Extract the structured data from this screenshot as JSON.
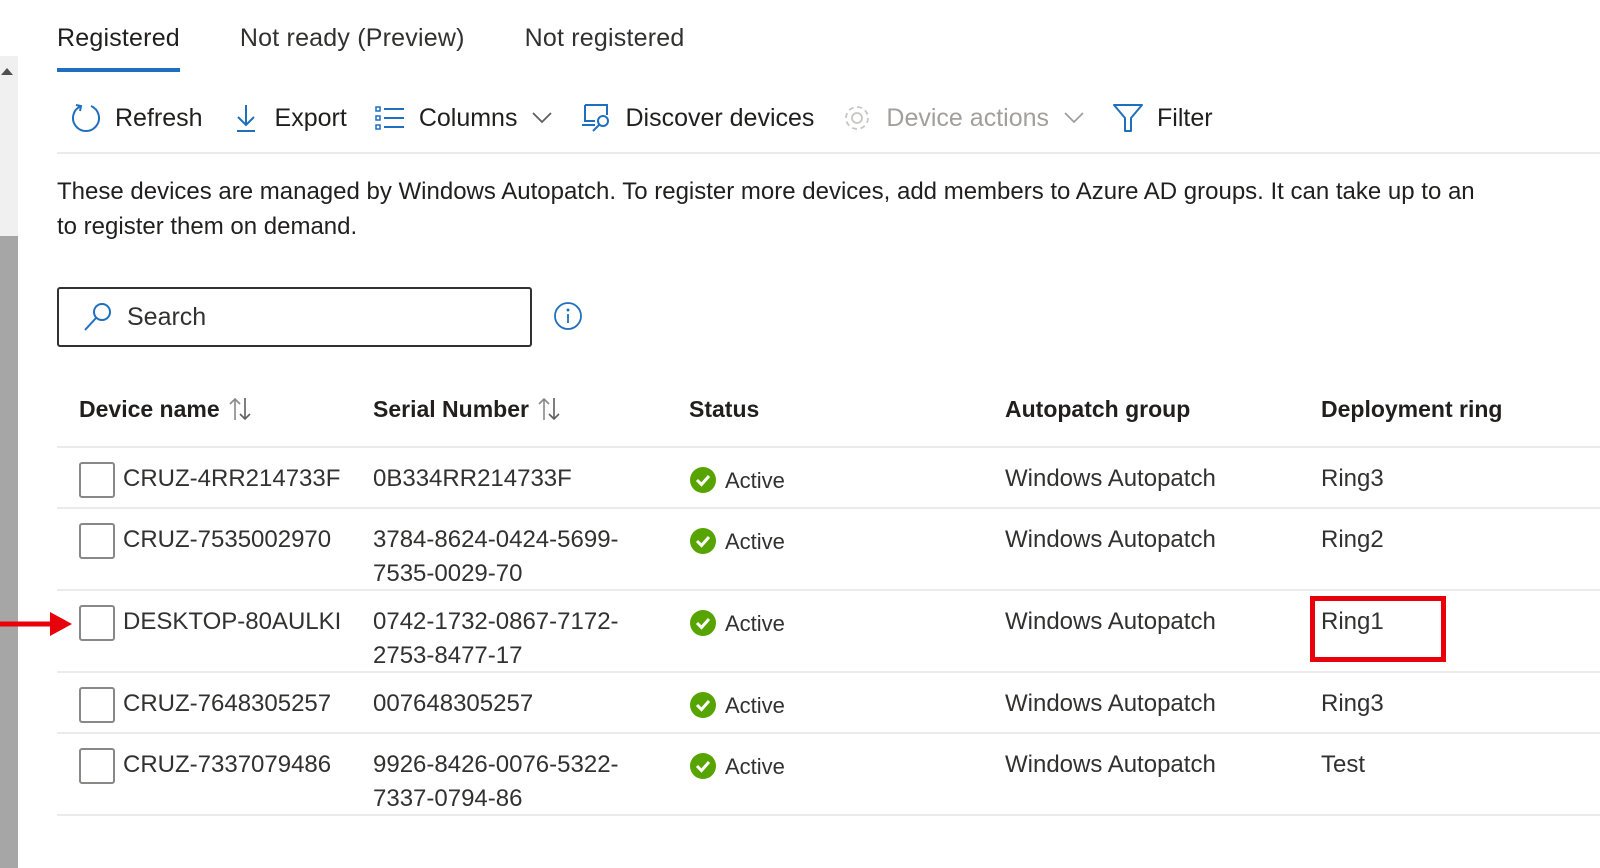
{
  "tabs": [
    {
      "label": "Registered",
      "active": true
    },
    {
      "label": "Not ready (Preview)",
      "active": false
    },
    {
      "label": "Not registered",
      "active": false
    }
  ],
  "toolbar": {
    "refresh_label": "Refresh",
    "export_label": "Export",
    "columns_label": "Columns",
    "discover_label": "Discover devices",
    "device_actions_label": "Device actions",
    "filter_label": "Filter"
  },
  "description": {
    "line1": "These devices are managed by Windows Autopatch. To register more devices, add members to Azure AD groups. It can take up to an",
    "line2": "to register them on demand."
  },
  "search": {
    "placeholder": "Search",
    "value": ""
  },
  "table": {
    "columns": [
      "Device name",
      "Serial Number",
      "Status",
      "Autopatch group",
      "Deployment ring"
    ],
    "rows": [
      {
        "device": "CRUZ-4RR214733F",
        "serial": "0B334RR214733F",
        "status": "Active",
        "group": "Windows Autopatch",
        "ring": "Ring3"
      },
      {
        "device": "CRUZ-7535002970",
        "serial": "3784-8624-0424-5699-7535-0029-70",
        "status": "Active",
        "group": "Windows Autopatch",
        "ring": "Ring2"
      },
      {
        "device": "DESKTOP-80AULKI",
        "serial": "0742-1732-0867-7172-2753-8477-17",
        "status": "Active",
        "group": "Windows Autopatch",
        "ring": "Ring1"
      },
      {
        "device": "CRUZ-7648305257",
        "serial": "007648305257",
        "status": "Active",
        "group": "Windows Autopatch",
        "ring": "Ring3"
      },
      {
        "device": "CRUZ-7337079486",
        "serial": "9926-8426-0076-5322-7337-0794-86",
        "status": "Active",
        "group": "Windows Autopatch",
        "ring": "Test"
      }
    ]
  },
  "annotations": {
    "highlighted_row": 2,
    "highlight_color": "#e8000b"
  },
  "colors": {
    "accent": "#1f6fbf",
    "status_ok": "#57a300"
  }
}
